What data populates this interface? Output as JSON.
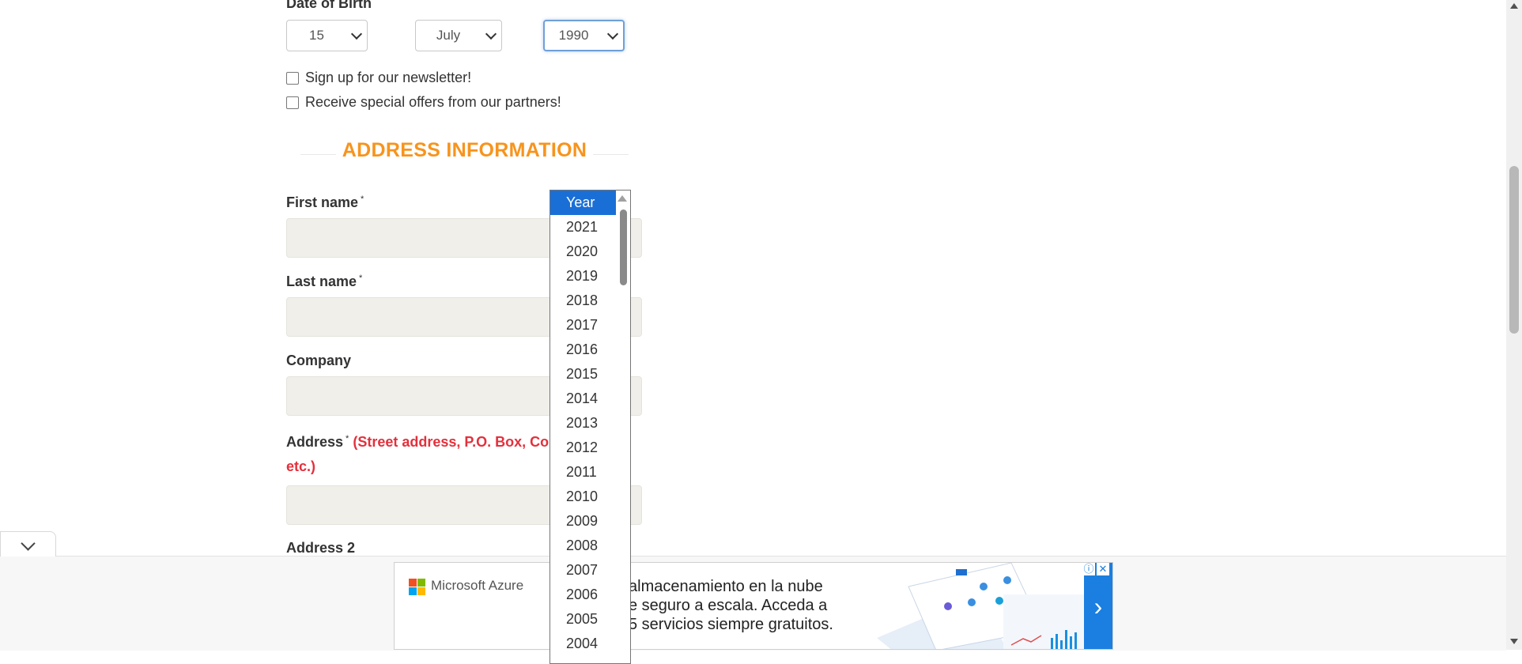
{
  "dob": {
    "label": "Date of Birth",
    "day": "15",
    "month": "July",
    "year": "1990"
  },
  "checkboxes": {
    "newsletter": "Sign up for our newsletter!",
    "offers": "Receive special offers from our partners!"
  },
  "section": {
    "title": "ADDRESS INFORMATION"
  },
  "fields": {
    "first_name": "First name",
    "last_name": "Last name",
    "company": "Company",
    "address": "Address",
    "address_hint": "(Street address, P.O. Box, Com",
    "address_hint_cont": "etc.)",
    "address2": "Address 2",
    "required_mark": "*"
  },
  "year_dropdown": {
    "options": [
      "Year",
      "2021",
      "2020",
      "2019",
      "2018",
      "2017",
      "2016",
      "2015",
      "2014",
      "2013",
      "2012",
      "2011",
      "2010",
      "2009",
      "2008",
      "2007",
      "2006",
      "2005",
      "2004"
    ],
    "highlighted": "Year"
  },
  "ad": {
    "brand": "Microsoft Azure",
    "line1": "almacenamiento en la nube",
    "line2": "e seguro a escala. Acceda a",
    "line3": "5 servicios siempre gratuitos.",
    "arrow": "›",
    "info": "ⓘ",
    "close": "✕"
  },
  "colors": {
    "accent_orange": "#f7941d",
    "hint_red": "#e4303c",
    "dropdown_highlight": "#1a6fd6",
    "ad_blue": "#1a7fe0"
  }
}
